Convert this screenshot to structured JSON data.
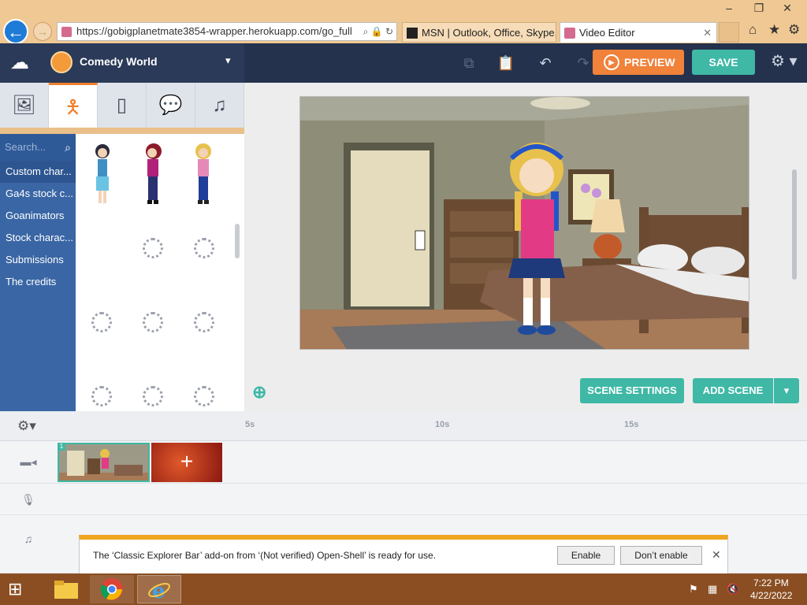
{
  "browser": {
    "url": "https://gobigplanetmate3854-wrapper.herokuapp.com/go_full",
    "tabs": [
      {
        "label": "MSN | Outlook, Office, Skype, ..."
      },
      {
        "label": "Video Editor"
      }
    ],
    "window_controls": {
      "minimize": "–",
      "maximize": "❐",
      "close": "✕"
    }
  },
  "app": {
    "theme_name": "Comedy World",
    "preview_label": "PREVIEW",
    "save_label": "SAVE",
    "search_placeholder": "Search...",
    "categories": [
      {
        "label": "Custom char..."
      },
      {
        "label": "Ga4s stock c..."
      },
      {
        "label": "Goanimators"
      },
      {
        "label": "Stock charac..."
      },
      {
        "label": "Submissions"
      },
      {
        "label": "The credits"
      }
    ],
    "library_tabs": [
      "image-icon",
      "character-icon",
      "prop-icon",
      "text-icon",
      "music-icon"
    ],
    "scene_settings_label": "SCENE SETTINGS",
    "add_scene_label": "ADD SCENE"
  },
  "timeline": {
    "ticks": [
      "5s",
      "10s",
      "15s"
    ],
    "scene_number": "1",
    "add_scene_symbol": "+"
  },
  "notification": {
    "text": "The ‘Classic Explorer Bar’ add-on from ‘(Not verified) Open-Shell’ is ready for use.",
    "enable_label": "Enable",
    "dont_enable_label": "Don’t enable"
  },
  "taskbar": {
    "time": "7:22 PM",
    "date": "4/22/2022"
  },
  "colors": {
    "app_bar": "#2a3a58",
    "accent_teal": "#3fb8a6",
    "preview_orange": "#f0823a",
    "category_blue": "#3a66a5",
    "taskbar": "#8a4e22"
  }
}
